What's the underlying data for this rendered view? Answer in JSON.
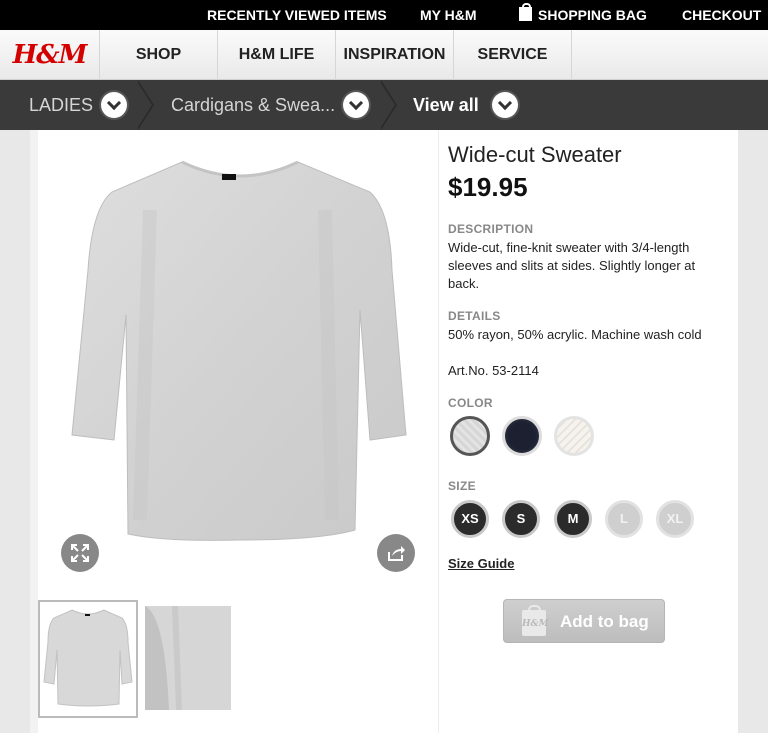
{
  "topbar": {
    "recently_viewed": "RECENTLY VIEWED ITEMS",
    "my_hm": "MY H&M",
    "shopping_bag": "SHOPPING BAG",
    "checkout": "CHECKOUT"
  },
  "nav": {
    "logo": "H&M",
    "tabs": [
      "SHOP",
      "H&M LIFE",
      "INSPIRATION",
      "SERVICE"
    ]
  },
  "breadcrumb": {
    "items": [
      "LADIES",
      "Cardigans & Swea...",
      "View all"
    ]
  },
  "product": {
    "title": "Wide-cut Sweater",
    "price": "$19.95",
    "description_label": "DESCRIPTION",
    "description": "Wide-cut, fine-knit sweater with 3/4-length sleeves and slits at sides. Slightly longer at back.",
    "details_label": "DETAILS",
    "details": "50% rayon, 50% acrylic. Machine wash cold",
    "art_no": "Art.No. 53-2114",
    "color_label": "COLOR",
    "colors": [
      {
        "name": "light-gray",
        "hex": "#d9d9d9",
        "selected": true
      },
      {
        "name": "dark-navy",
        "hex": "#1c2030",
        "selected": false
      },
      {
        "name": "off-white",
        "hex": "#f6f3ef",
        "selected": false
      }
    ],
    "size_label": "SIZE",
    "sizes": [
      {
        "label": "XS",
        "available": true
      },
      {
        "label": "S",
        "available": true
      },
      {
        "label": "M",
        "available": true
      },
      {
        "label": "L",
        "available": false
      },
      {
        "label": "XL",
        "available": false
      }
    ],
    "size_guide": "Size Guide",
    "add_to_bag": "Add to bag",
    "bag_icon_text": "H&M"
  },
  "icons": {
    "expand": "expand-icon",
    "share": "share-icon",
    "chevron": "chevron-down-icon",
    "bag": "shopping-bag-icon"
  },
  "colors": {
    "brand_red": "#d40000",
    "topbar": "#000000",
    "breadcrumb_bg": "#3a3a3a"
  }
}
